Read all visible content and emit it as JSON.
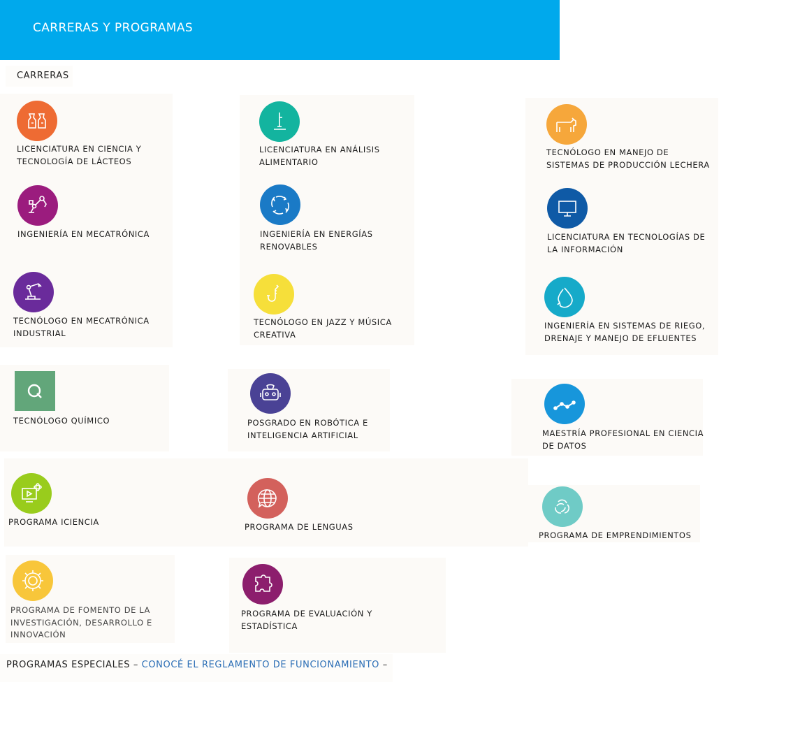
{
  "header": {
    "title": "CARRERAS Y PROGRAMAS",
    "color": "#00a9ec"
  },
  "carreras_label": "CARRERAS",
  "cards": [
    {
      "label": "LICENCIATURA EN CIENCIA Y TECNOLOGÍA DE LÁCTEOS",
      "icon": "dairy-bottles-icon",
      "color": "#ee6b33"
    },
    {
      "label": "LICENCIATURA EN ANÁLISIS ALIMENTARIO",
      "icon": "microscope-icon",
      "color": "#13b49f"
    },
    {
      "label": "TECNÓLOGO EN MANEJO DE SISTEMAS DE PRODUCCIÓN LECHERA",
      "icon": "cow-icon",
      "color": "#f6a73b"
    },
    {
      "label": "INGENIERÍA EN MECATRÓNICA",
      "icon": "robot-arm-icon",
      "color": "#9b1c7e"
    },
    {
      "label": "INGENIERÍA EN ENERGÍAS RENOVABLES",
      "icon": "renewable-cycle-icon",
      "color": "#1a7ac6"
    },
    {
      "label": "LICENCIATURA EN TECNOLOGÍAS DE LA INFORMACIÓN",
      "icon": "monitor-icon",
      "color": "#0f5aa6"
    },
    {
      "label": "TECNÓLOGO EN MECATRÓNICA INDUSTRIAL",
      "icon": "industrial-arm-icon",
      "color": "#6a2b9b"
    },
    {
      "label": "TECNÓLOGO EN JAZZ Y MÚSICA CREATIVA",
      "icon": "saxophone-icon",
      "color": "#f6df3a"
    },
    {
      "label": "INGENIERÍA EN SISTEMAS DE RIEGO, DRENAJE Y MANEJO DE EFLUENTES",
      "icon": "water-drop-cycle-icon",
      "color": "#16aac9"
    },
    {
      "label": "TECNÓLOGO QUÍMICO",
      "icon": "q-letter-icon",
      "color": "#62a67a"
    },
    {
      "label": "POSGRADO EN ROBÓTICA E INTELIGENCIA ARTIFICIAL",
      "icon": "robot-head-icon",
      "color": "#4a4295"
    },
    {
      "label": "MAESTRÍA PROFESIONAL EN CIENCIA DE DATOS",
      "icon": "data-line-icon",
      "color": "#1796db"
    },
    {
      "label": "PROGRAMA ICIENCIA",
      "icon": "video-atom-icon",
      "color": "#99cc1c"
    },
    {
      "label": "PROGRAMA DE LENGUAS",
      "icon": "globe-chat-icon",
      "color": "#d3615c"
    },
    {
      "label": "PROGRAMA DE EMPRENDIMIENTOS",
      "icon": "interlock-icon",
      "color": "#6fcbc6"
    },
    {
      "label": "PROGRAMA DE FOMENTO DE LA INVESTIGACIÓN, DESARROLLO E INNOVACIÓN",
      "icon": "gear-sun-icon",
      "color": "#f8c63a"
    },
    {
      "label": "PROGRAMA DE EVALUACIÓN Y ESTADÍSTICA",
      "icon": "puzzle-icon",
      "color": "#8c1e6d"
    }
  ],
  "footer": {
    "prefix": "PROGRAMAS ESPECIALES –",
    "link": "CONOCÉ EL REGLAMENTO DE FUNCIONAMIENTO",
    "suffix": "–"
  }
}
